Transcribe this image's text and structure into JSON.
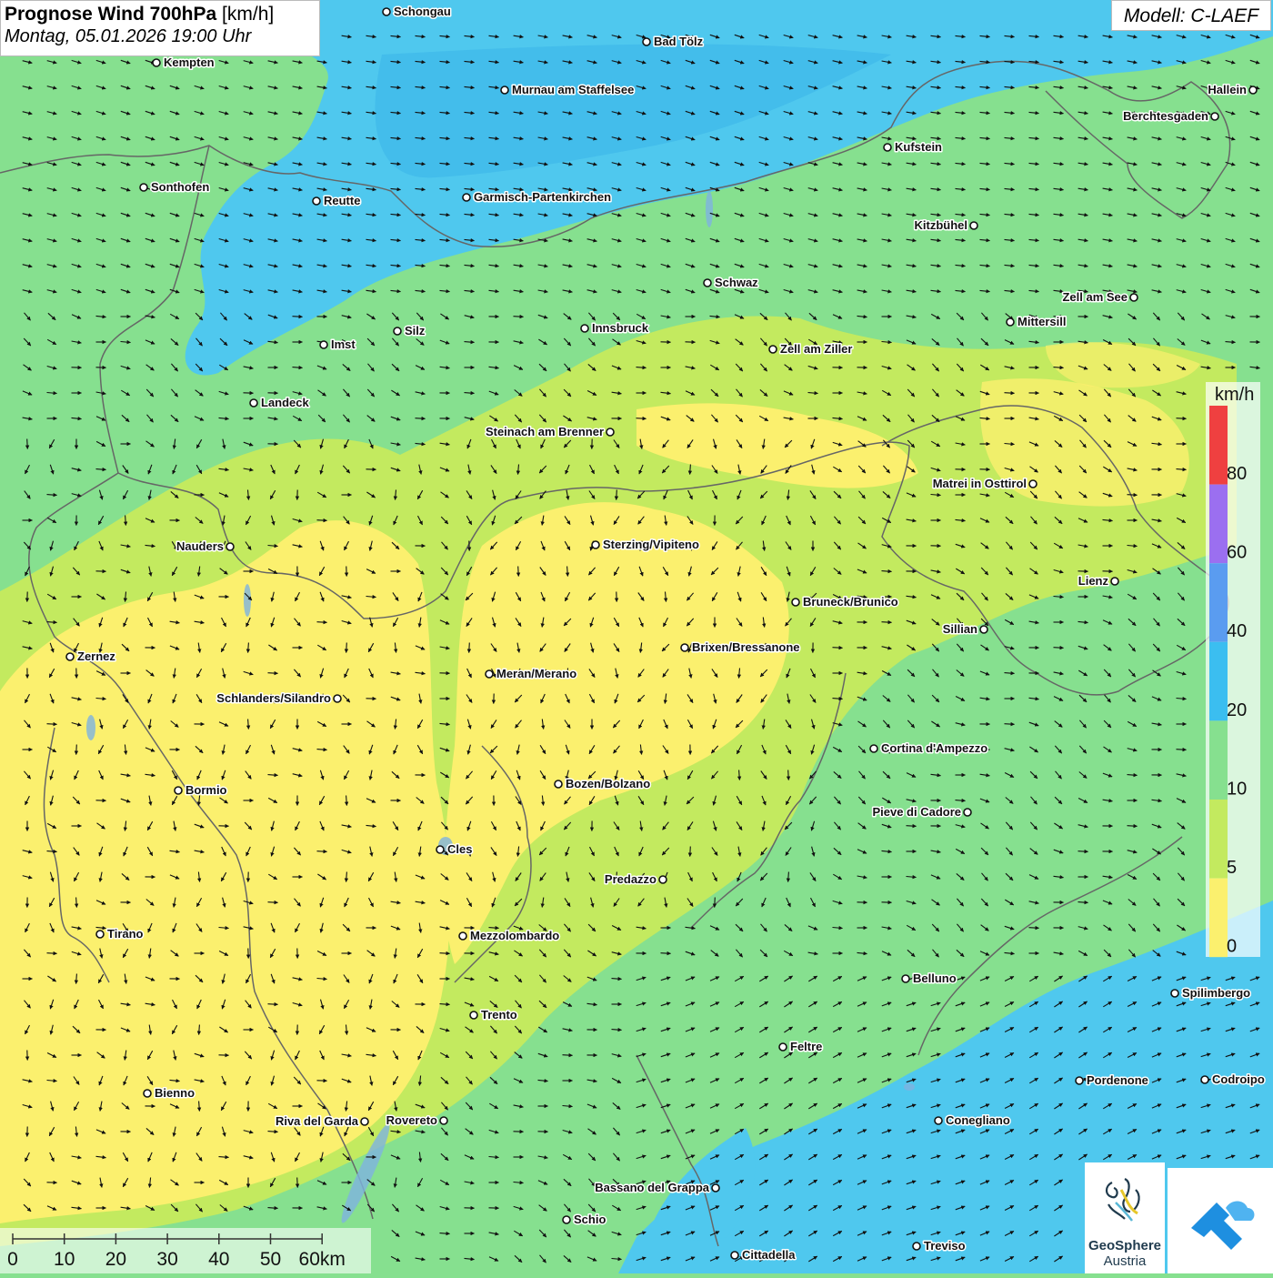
{
  "header": {
    "title": "Prognose Wind 700hPa",
    "unit": "[km/h]",
    "datetime": "Montag, 05.01.2026 19:00 Uhr"
  },
  "model_label": "Modell: C-LAEF",
  "legend": {
    "unit": "km/h",
    "ticks": [
      "80",
      "60",
      "40",
      "20",
      "10",
      "5",
      "0"
    ],
    "colors": [
      "#ef4040",
      "#9b6ff0",
      "#5a9cf0",
      "#3bbef0",
      "#86e08f",
      "#c3ea5f",
      "#fbf06e"
    ]
  },
  "scale_bar": {
    "labels": [
      "0",
      "10",
      "20",
      "30",
      "40",
      "50",
      "60km"
    ]
  },
  "logo": {
    "geosphere_line1": "GeoSphere",
    "geosphere_line2": "Austria",
    "geosphere_icon": "geosphere-logo-icon",
    "app_icon": "weather-app-icon"
  },
  "places": [
    {
      "name": "Schongau"
    },
    {
      "name": "Bad Tölz"
    },
    {
      "name": "Kempten"
    },
    {
      "name": "Murnau am Staffelsee"
    },
    {
      "name": "Hallein"
    },
    {
      "name": "Berchtesgaden"
    },
    {
      "name": "Kufstein"
    },
    {
      "name": "Sonthofen"
    },
    {
      "name": "Reutte"
    },
    {
      "name": "Garmisch-Partenkirchen"
    },
    {
      "name": "Kitzbühel"
    },
    {
      "name": "Schwaz"
    },
    {
      "name": "Zell am See"
    },
    {
      "name": "Mittersill"
    },
    {
      "name": "Innsbruck"
    },
    {
      "name": "Silz"
    },
    {
      "name": "Imst"
    },
    {
      "name": "Zell am Ziller"
    },
    {
      "name": "Landeck"
    },
    {
      "name": "Steinach am Brenner"
    },
    {
      "name": "Matrei in Osttirol"
    },
    {
      "name": "Nauders"
    },
    {
      "name": "Sterzing/Vipiteno"
    },
    {
      "name": "Lienz"
    },
    {
      "name": "Bruneck/Brunico"
    },
    {
      "name": "Sillian"
    },
    {
      "name": "Zernez"
    },
    {
      "name": "Brixen/Bressanone"
    },
    {
      "name": "Meran/Merano"
    },
    {
      "name": "Schlanders/Silandro"
    },
    {
      "name": "Cortina d'Ampezzo"
    },
    {
      "name": "Bozen/Bolzano"
    },
    {
      "name": "Bormio"
    },
    {
      "name": "Pieve di Cadore"
    },
    {
      "name": "Cles"
    },
    {
      "name": "Predazzo"
    },
    {
      "name": "Tirano"
    },
    {
      "name": "Mezzolombardo"
    },
    {
      "name": "Belluno"
    },
    {
      "name": "Spilimbergo"
    },
    {
      "name": "Trento"
    },
    {
      "name": "Feltre"
    },
    {
      "name": "Pordenone"
    },
    {
      "name": "Codroipo"
    },
    {
      "name": "Bienno"
    },
    {
      "name": "Riva del Garda"
    },
    {
      "name": "Rovereto"
    },
    {
      "name": "Conegliano"
    },
    {
      "name": "Bassano del Grappa"
    },
    {
      "name": "Schio"
    },
    {
      "name": "Treviso"
    },
    {
      "name": "Cittadella"
    }
  ],
  "colors": {
    "wind_0_5": "#fbf06e",
    "wind_5_10": "#c3ea5f",
    "wind_10_20": "#86e08f",
    "wind_20_40": "#4fc8ee",
    "border": "#666666"
  }
}
